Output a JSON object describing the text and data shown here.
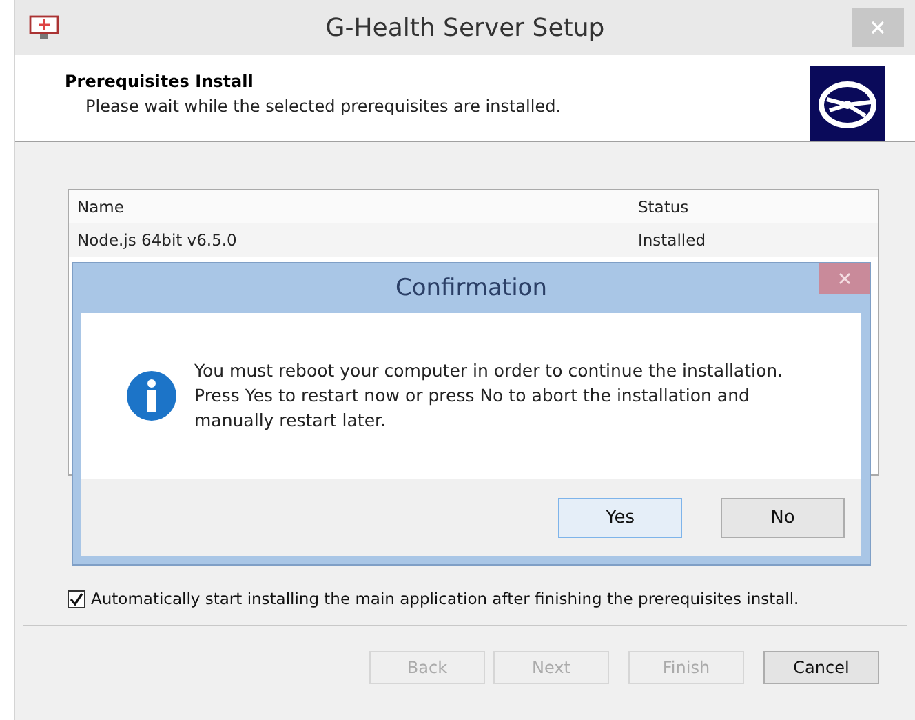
{
  "window": {
    "title": "G-Health Server Setup"
  },
  "header": {
    "title": "Prerequisites Install",
    "subtitle": "Please wait while the selected prerequisites are installed."
  },
  "list": {
    "columns": [
      "Name",
      "Status"
    ],
    "rows": [
      {
        "name": "Node.js 64bit v6.5.0",
        "status": "Installed"
      }
    ]
  },
  "dialog": {
    "title": "Confirmation",
    "message": "You must reboot your computer in order to continue the installation. Press Yes to restart now or press No to abort the installation and manually restart later.",
    "buttons": [
      {
        "label": "Yes",
        "selected": true
      },
      {
        "label": "No",
        "selected": false
      }
    ]
  },
  "checkbox": {
    "label": "Automatically start installing the main application after finishing the prerequisites install.",
    "checked": true
  },
  "buttons": [
    {
      "label": "Back",
      "disabled": true
    },
    {
      "label": "Next",
      "disabled": true
    },
    {
      "label": "Finish",
      "disabled": true
    },
    {
      "label": "Cancel",
      "disabled": false
    }
  ]
}
